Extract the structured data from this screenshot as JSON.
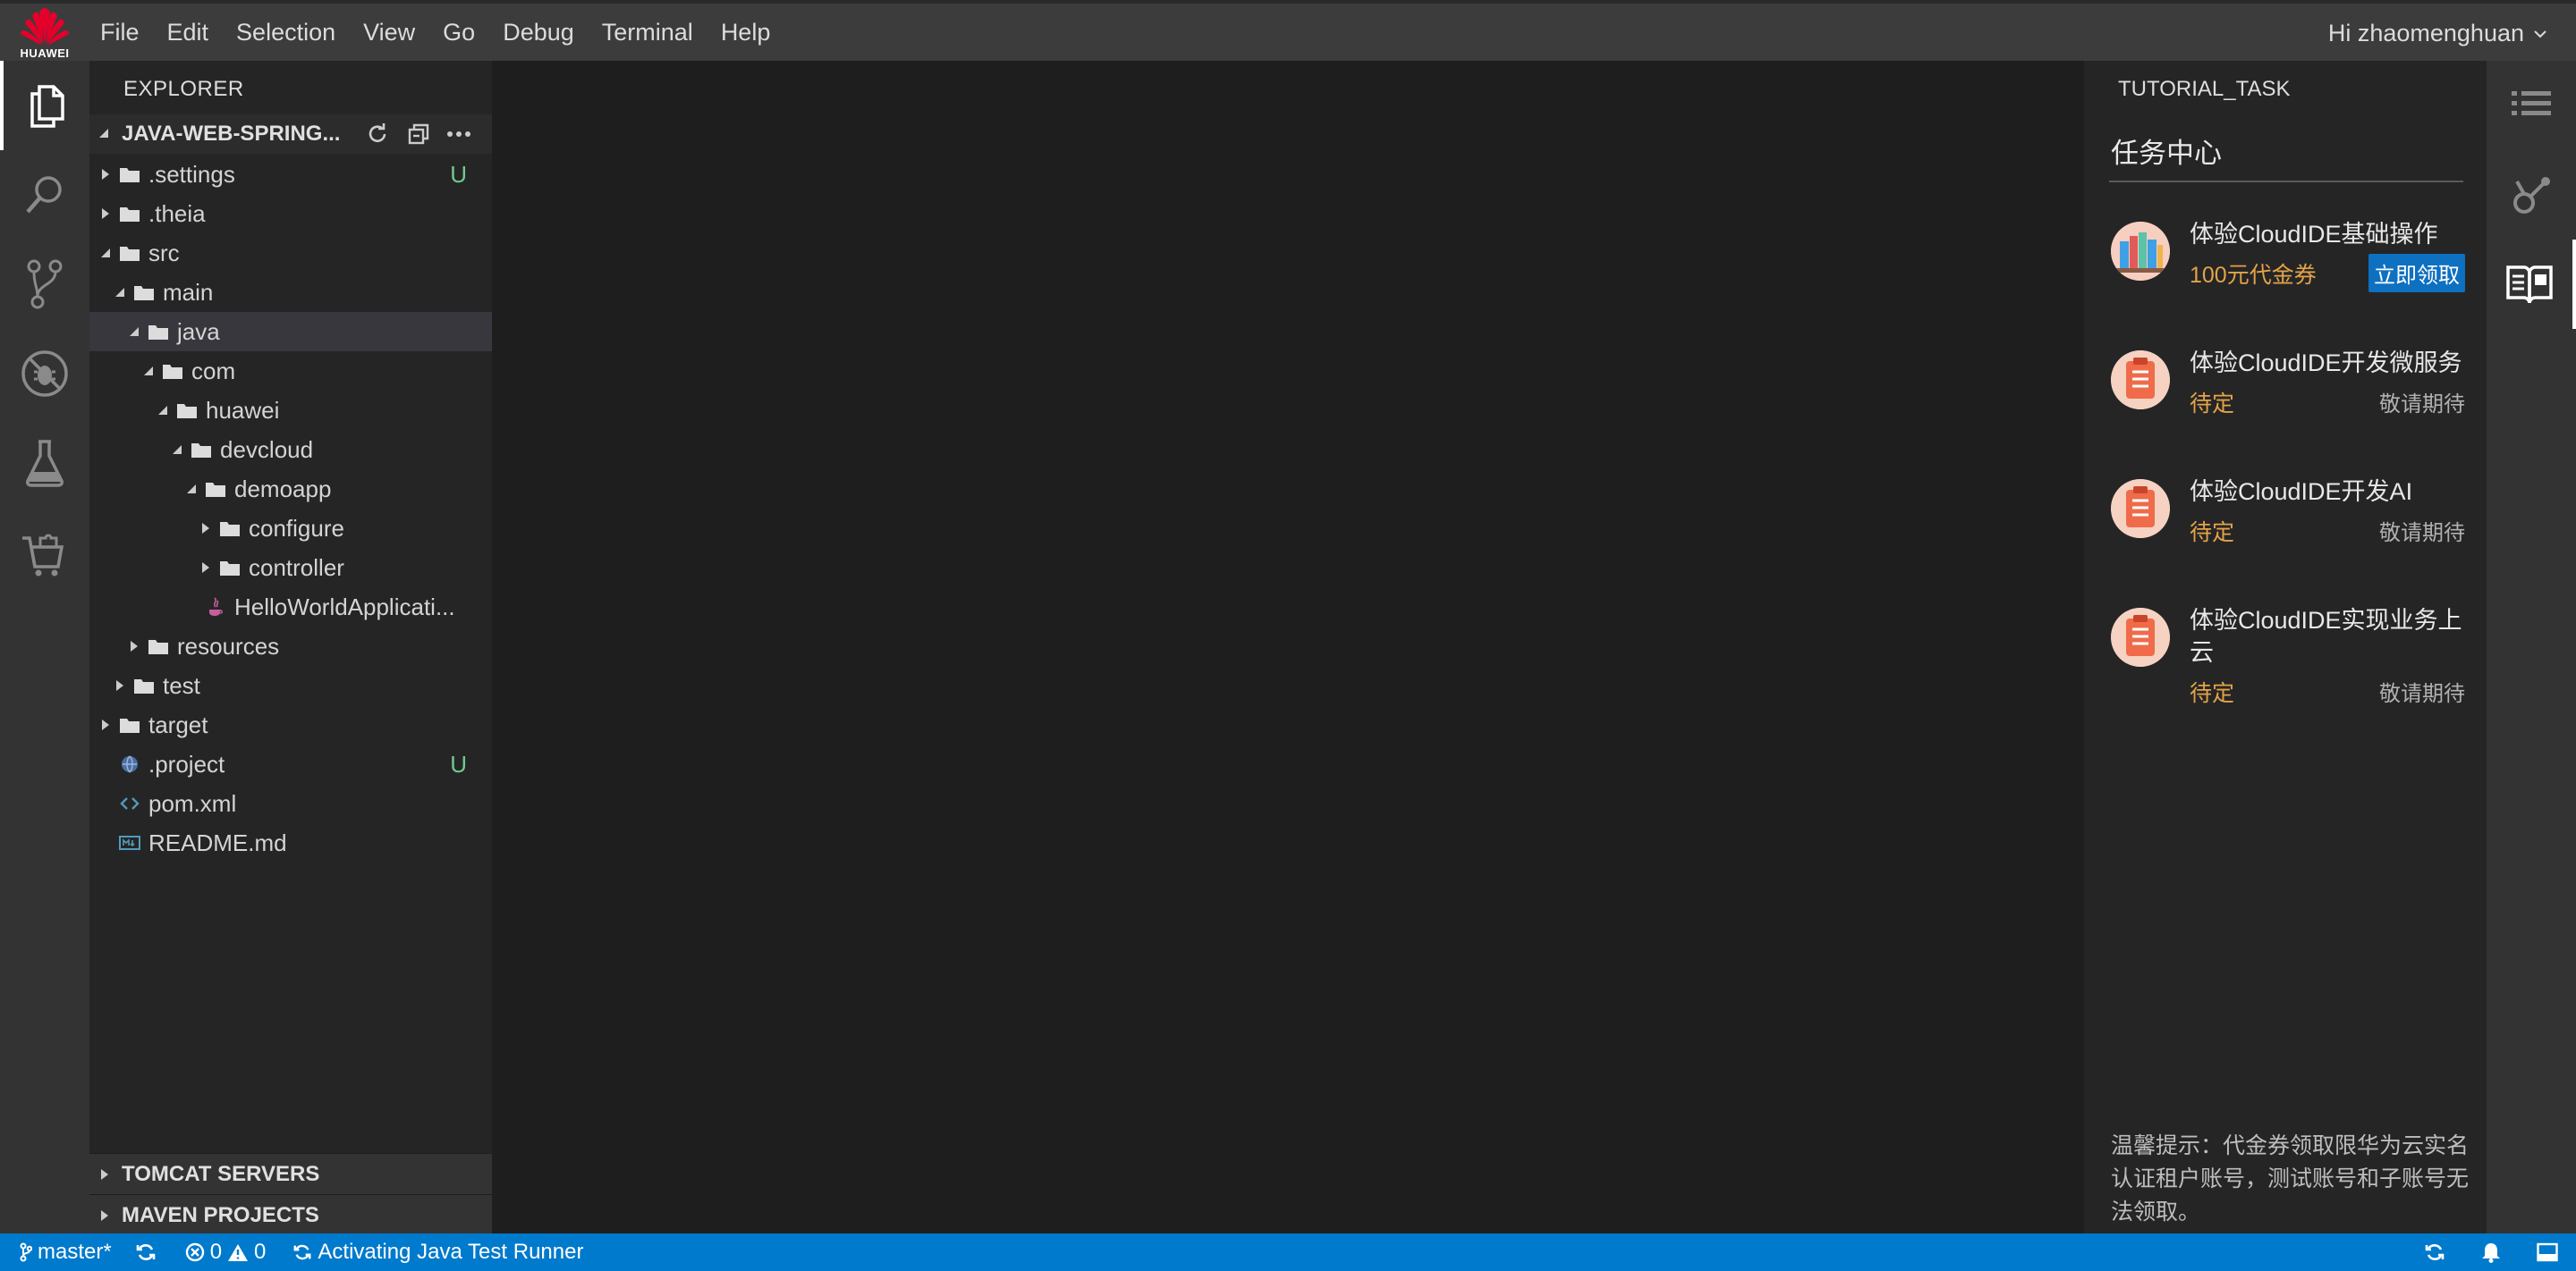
{
  "brand": {
    "name": "HUAWEI",
    "color": "#e4002b"
  },
  "menu": [
    "File",
    "Edit",
    "Selection",
    "View",
    "Go",
    "Debug",
    "Terminal",
    "Help"
  ],
  "user": {
    "greeting": "Hi zhaomenghuan"
  },
  "activity_bar": [
    "explorer-icon",
    "search-icon",
    "source-control-icon",
    "debug-icon",
    "test-flask-icon",
    "extensions-icon"
  ],
  "explorer": {
    "title": "EXPLORER",
    "project": "JAVA-WEB-SPRING...",
    "tree": [
      {
        "label": ".settings",
        "type": "folder",
        "state": "collapsed",
        "badge": "U"
      },
      {
        "label": ".theia",
        "type": "folder",
        "state": "collapsed"
      },
      {
        "label": "src",
        "type": "folder",
        "state": "expanded"
      },
      {
        "label": "main",
        "type": "folder",
        "state": "expanded"
      },
      {
        "label": "java",
        "type": "folder",
        "state": "expanded",
        "selected": true
      },
      {
        "label": "com",
        "type": "folder",
        "state": "expanded"
      },
      {
        "label": "huawei",
        "type": "folder",
        "state": "expanded"
      },
      {
        "label": "devcloud",
        "type": "folder",
        "state": "expanded"
      },
      {
        "label": "demoapp",
        "type": "folder",
        "state": "expanded"
      },
      {
        "label": "configure",
        "type": "folder",
        "state": "collapsed"
      },
      {
        "label": "controller",
        "type": "folder",
        "state": "collapsed"
      },
      {
        "label": "HelloWorldApplicati...",
        "type": "java-file"
      },
      {
        "label": "resources",
        "type": "folder",
        "state": "collapsed"
      },
      {
        "label": "test",
        "type": "folder",
        "state": "collapsed"
      },
      {
        "label": "target",
        "type": "folder",
        "state": "collapsed"
      },
      {
        "label": ".project",
        "type": "project-file",
        "badge": "U"
      },
      {
        "label": "pom.xml",
        "type": "xml-file"
      },
      {
        "label": "README.md",
        "type": "md-file"
      }
    ],
    "bottom_sections": [
      "TOMCAT SERVERS",
      "MAVEN PROJECTS"
    ]
  },
  "tutorial": {
    "title": "TUTORIAL_TASK",
    "heading": "任务中心",
    "tasks": [
      {
        "name": "体验CloudIDE基础操作",
        "status": "100元代金券",
        "action": "立即领取",
        "icon": "books-icon"
      },
      {
        "name": "体验CloudIDE开发微服务",
        "status": "待定",
        "action": "敬请期待",
        "icon": "clipboard-icon"
      },
      {
        "name": "体验CloudIDE开发AI",
        "status": "待定",
        "action": "敬请期待",
        "icon": "clipboard-icon"
      },
      {
        "name": "体验CloudIDE实现业务上云",
        "status": "待定",
        "action": "敬请期待",
        "icon": "clipboard-icon"
      }
    ],
    "tip": "温馨提示：代金券领取限华为云实名认证租户账号，测试账号和子账号无法领取。"
  },
  "right_bar": [
    "outline-icon",
    "deploy-icon",
    "tutorial-icon"
  ],
  "status": {
    "branch": "master*",
    "errors": "0",
    "warnings": "0",
    "message": "Activating Java Test Runner",
    "accent": "#007acc"
  }
}
